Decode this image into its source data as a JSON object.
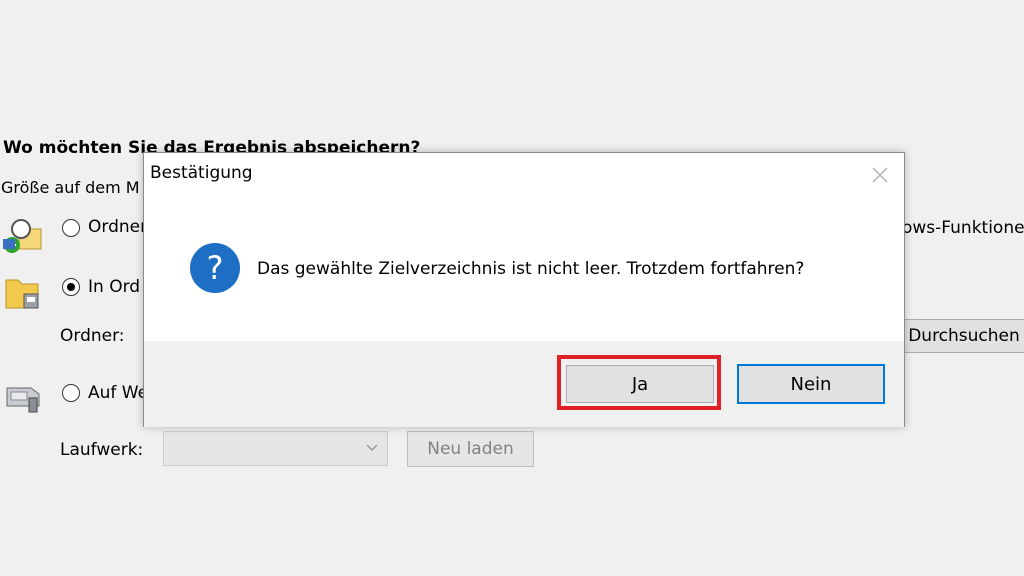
{
  "background": {
    "section_title": "Wo möchten Sie das Ergebnis abspeichern?",
    "size_label": "Größe auf dem M",
    "option_folder": {
      "label": "Ordner",
      "selected": false
    },
    "option_in_folder": {
      "label": "In Ord",
      "selected": true
    },
    "option_drive": {
      "label": "Auf We",
      "selected": false
    },
    "folder_label": "Ordner:",
    "browse_button": "Durchsuchen",
    "right_text": "ows-Funktionen",
    "drive_label": "Laufwerk:",
    "drive_value": "",
    "reload_button": "Neu laden"
  },
  "dialog": {
    "title": "Bestätigung",
    "message": "Das gewählte Zielverzeichnis ist nicht leer. Trotzdem fortfahren?",
    "yes_button": "Ja",
    "no_button": "Nein",
    "icon": "question-icon",
    "close_icon": "close-icon"
  },
  "colors": {
    "highlight": "#e01f26",
    "focus_border": "#0078d7",
    "question_blue": "#1c6fc4"
  }
}
